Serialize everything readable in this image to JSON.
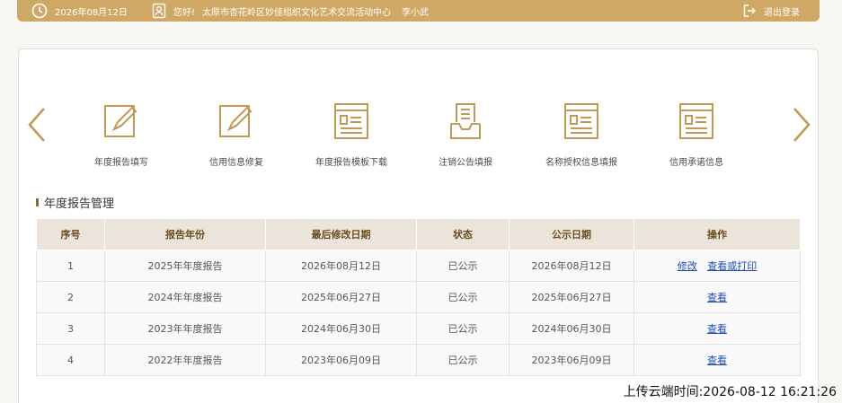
{
  "topbar": {
    "date": "2026年08月12日",
    "greeting": "您好!",
    "org": "太原市杏花岭区妙佳组织文化艺术交流活动中心",
    "user": "李小武",
    "logout": "退出登录"
  },
  "carousel": {
    "items": [
      {
        "label": "年度报告填写",
        "icon": "edit-form-icon"
      },
      {
        "label": "信用信息修复",
        "icon": "edit-form-icon"
      },
      {
        "label": "年度报告模板下载",
        "icon": "document-panel-icon"
      },
      {
        "label": "注销公告填报",
        "icon": "inbox-tray-icon"
      },
      {
        "label": "名称授权信息填报",
        "icon": "document-panel-icon"
      },
      {
        "label": "信用承诺信息",
        "icon": "document-panel-icon"
      }
    ]
  },
  "section": {
    "title": "年度报告管理"
  },
  "table": {
    "headers": [
      "序号",
      "报告年份",
      "最后修改日期",
      "状态",
      "公示日期",
      "操作"
    ],
    "rows": [
      {
        "index": "1",
        "year": "2025年年度报告",
        "modified": "2026年08月12日",
        "status": "已公示",
        "published": "2026年08月12日",
        "actions": [
          "修改",
          "查看或打印"
        ]
      },
      {
        "index": "2",
        "year": "2024年年度报告",
        "modified": "2025年06月27日",
        "status": "已公示",
        "published": "2025年06月27日",
        "actions": [
          "查看"
        ]
      },
      {
        "index": "3",
        "year": "2023年年度报告",
        "modified": "2024年06月30日",
        "status": "已公示",
        "published": "2024年06月30日",
        "actions": [
          "查看"
        ]
      },
      {
        "index": "4",
        "year": "2022年年度报告",
        "modified": "2023年06月09日",
        "status": "已公示",
        "published": "2023年06月09日",
        "actions": [
          "查看"
        ]
      }
    ]
  },
  "footer": {
    "upload_time": "上传云端时间:2026-08-12 16:21:26"
  },
  "colors": {
    "accent": "#cfa865",
    "icon": "#c39a55",
    "header_bg": "#ebe4da",
    "header_text": "#6b4c1f",
    "link": "#1e4db7"
  }
}
